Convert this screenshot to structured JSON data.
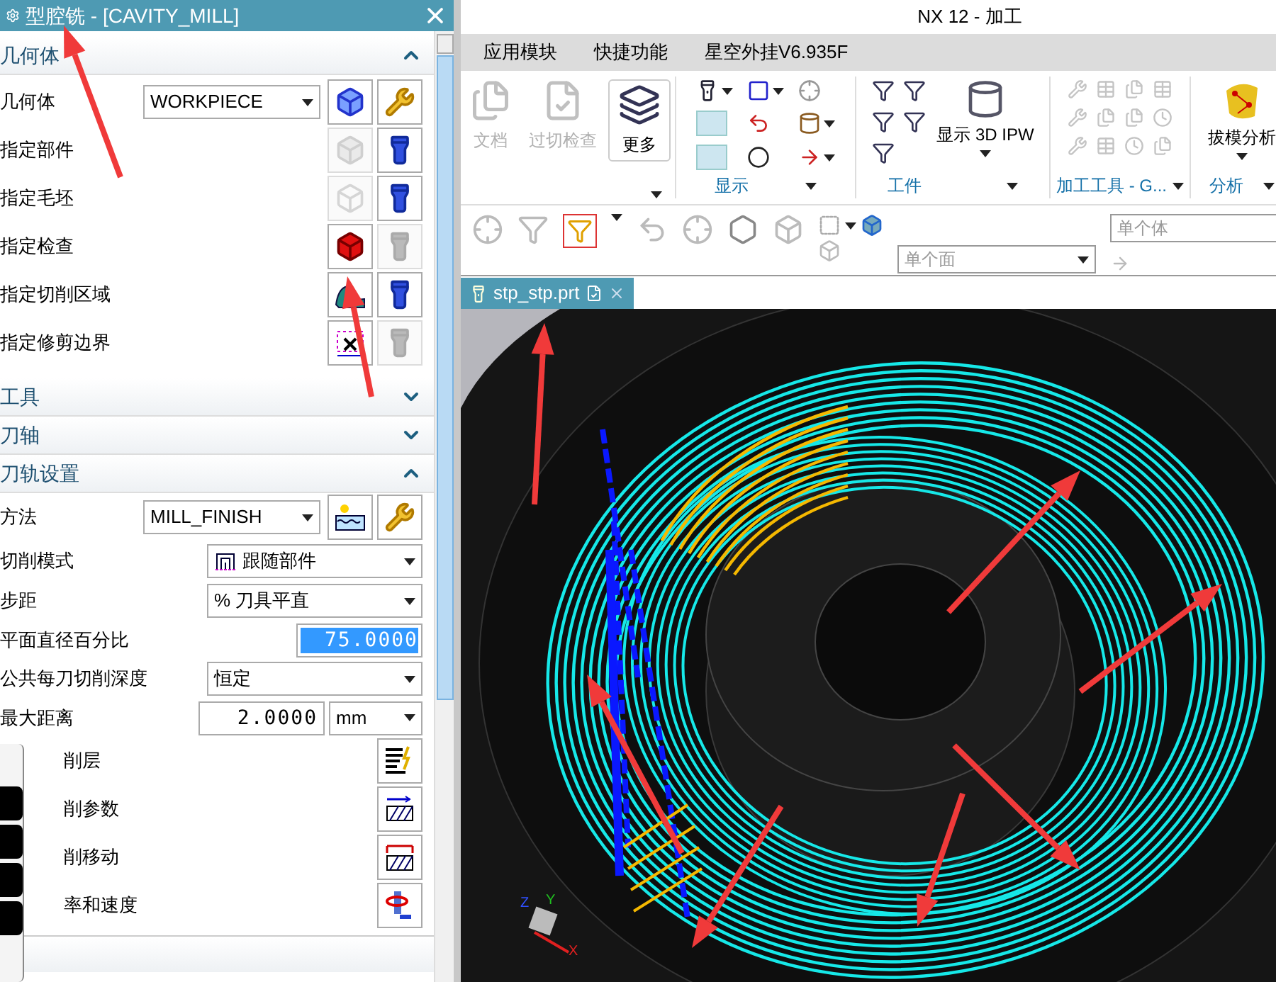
{
  "dialog": {
    "title": "型腔铣 - [CAVITY_MILL]",
    "sections": [
      {
        "title": "几何体",
        "expanded": true,
        "rows": [
          {
            "kind": "select",
            "label": "几何体",
            "value": "WORKPIECE",
            "tools": [
              {
                "disabled": false
              },
              {
                "disabled": false
              }
            ]
          },
          {
            "kind": "pick",
            "label": "指定部件",
            "tools": [
              {
                "disabled": true
              },
              {
                "disabled": false
              }
            ]
          },
          {
            "kind": "pick",
            "label": "指定毛坯",
            "tools": [
              {
                "disabled": true
              },
              {
                "disabled": false
              }
            ]
          },
          {
            "kind": "pick",
            "label": "指定检查",
            "tools": [
              {
                "disabled": false
              },
              {
                "disabled": true
              }
            ]
          },
          {
            "kind": "pick",
            "label": "指定切削区域",
            "tools": [
              {
                "disabled": false
              },
              {
                "disabled": false
              }
            ]
          },
          {
            "kind": "pick",
            "label": "指定修剪边界",
            "tools": [
              {
                "disabled": false
              },
              {
                "disabled": true
              }
            ]
          }
        ]
      },
      {
        "title": "工具",
        "expanded": false
      },
      {
        "title": "刀轴",
        "expanded": false
      },
      {
        "title": "刀轨设置",
        "expanded": true,
        "rows": [
          {
            "kind": "select",
            "label": "方法",
            "value": "MILL_FINISH",
            "tools": [
              {
                "disabled": false
              },
              {
                "disabled": false
              }
            ]
          },
          {
            "kind": "combo",
            "label": "切削模式",
            "value": "跟随部件"
          },
          {
            "kind": "combo",
            "label": "步距",
            "value": "% 刀具平直"
          },
          {
            "kind": "field",
            "label": "平面直径百分比",
            "value": "75.0000",
            "selected": true
          },
          {
            "kind": "combo",
            "label": "公共每刀切削深度",
            "value": "恒定"
          },
          {
            "kind": "field_unit",
            "label": "最大距离",
            "value": "2.0000",
            "unit": "mm"
          },
          {
            "kind": "button",
            "label": "削层"
          },
          {
            "kind": "button",
            "label": "削参数"
          },
          {
            "kind": "button",
            "label": "削移动"
          },
          {
            "kind": "button",
            "label": "率和速度"
          }
        ]
      }
    ]
  },
  "app": {
    "title": "NX 12 - 加工",
    "menu": [
      "应用模块",
      "快捷功能",
      "星空外挂V6.935F"
    ],
    "ribbon": {
      "buttons": [
        {
          "label": "文档",
          "disabled": true
        },
        {
          "label": "过切检查",
          "disabled": true
        },
        {
          "label": "更多",
          "disabled": false
        }
      ],
      "groups": [
        "显示",
        "工件",
        "加工工具 - G...",
        "分析"
      ],
      "ipw": "显示 3D IPW",
      "draft": "拔模分析"
    },
    "toolbar": {
      "body_filter": "单个体",
      "face_filter": "单个面"
    },
    "tab": {
      "label": "stp_stp.prt",
      "selected": true
    },
    "axes": [
      "Z",
      "Y",
      "X"
    ]
  }
}
